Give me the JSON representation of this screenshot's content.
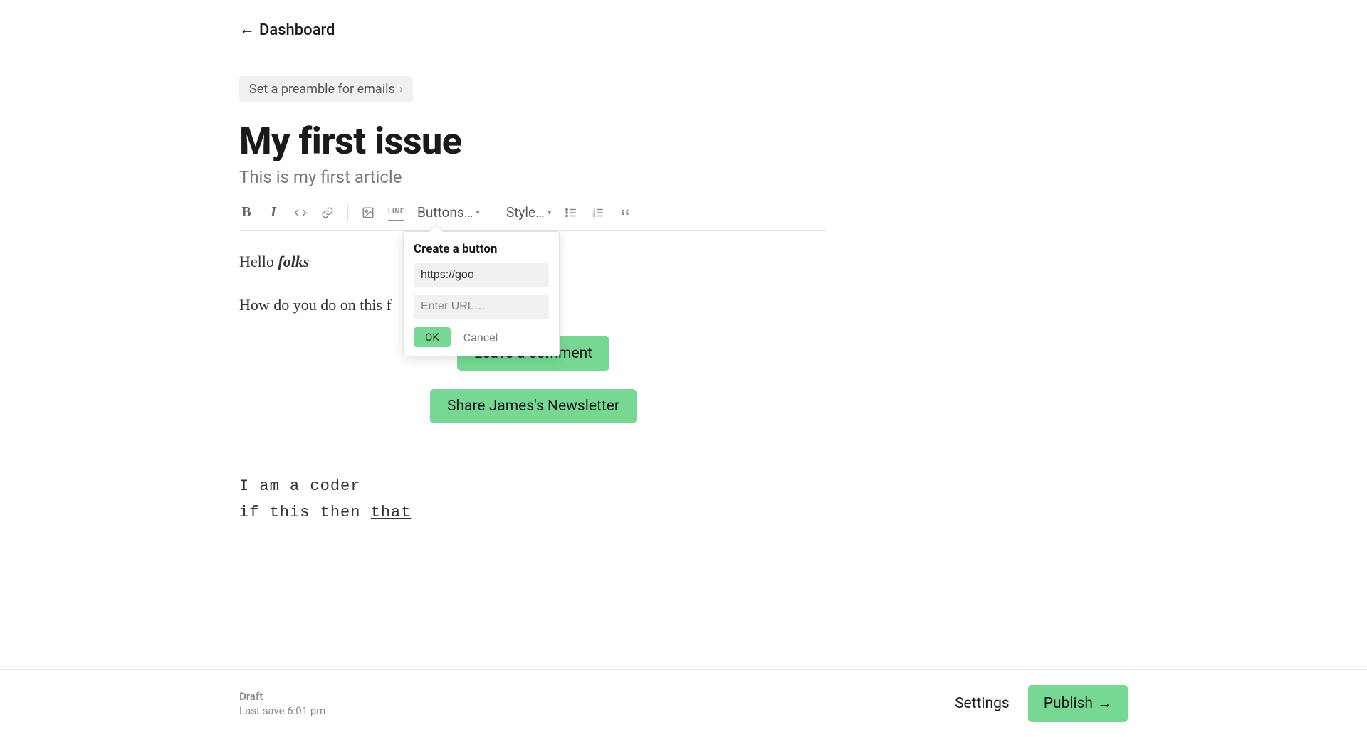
{
  "nav": {
    "back_label": "Dashboard"
  },
  "preamble": {
    "label": "Set a preamble for emails"
  },
  "post": {
    "title": "My first issue",
    "subtitle": "This is my first article"
  },
  "toolbar": {
    "buttons_label": "Buttons…",
    "style_label": "Style…",
    "line_label": "LINE"
  },
  "editor": {
    "para1_prefix": "Hello ",
    "para1_emph": "folks",
    "para2": "How do you do on this f",
    "button1": "Leave a comment",
    "button2": "Share James's Newsletter",
    "code_line1": "I am a coder",
    "code_line2_prefix": "if this then ",
    "code_line2_under": "that"
  },
  "popover": {
    "title": "Create a button",
    "input1_value": "https://goo",
    "input2_placeholder": "Enter URL…",
    "ok": "OK",
    "cancel": "Cancel"
  },
  "footer": {
    "status": "Draft",
    "last_save": "Last save 6:01 pm",
    "settings": "Settings",
    "publish": "Publish"
  }
}
